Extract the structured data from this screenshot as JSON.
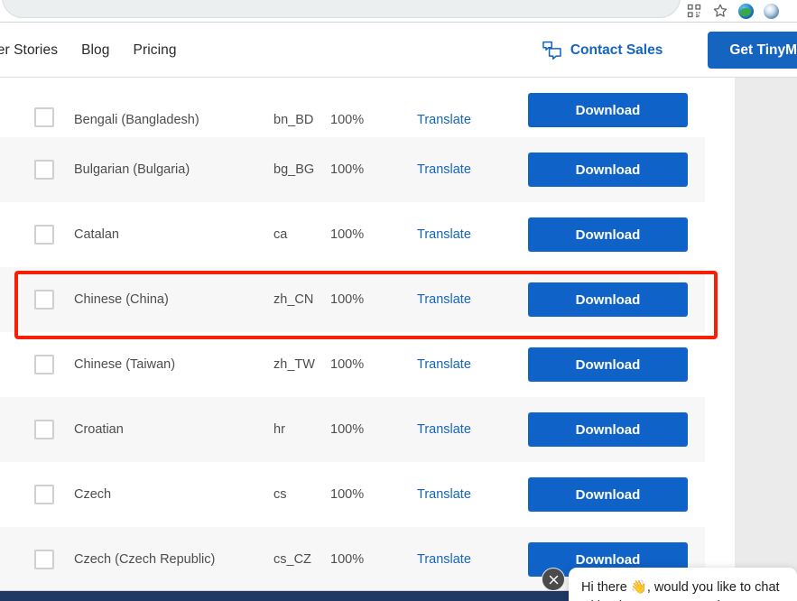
{
  "browser": {
    "icons": [
      {
        "name": "qr-code-icon",
        "glyph": "qr"
      },
      {
        "name": "bookmark-star-icon",
        "glyph": "star"
      },
      {
        "name": "extension-globe-icon",
        "glyph": "globe"
      },
      {
        "name": "extension-swirl-icon",
        "glyph": "swirl"
      }
    ]
  },
  "header": {
    "nav_links": [
      {
        "label": "ner Stories"
      },
      {
        "label": "Blog"
      },
      {
        "label": "Pricing"
      }
    ],
    "contact_sales_label": "Contact Sales",
    "contact_sales_icon": "chat-bubbles-icon",
    "cta_label": "Get TinyM",
    "accent_color": "#1565c0"
  },
  "table": {
    "columns": [
      "select",
      "language",
      "code",
      "progress",
      "translate",
      "download"
    ],
    "translate_label": "Translate",
    "download_label": "Download",
    "rows": [
      {
        "language": "Bengali (Bangladesh)",
        "code": "bn_BD",
        "progress": "100%",
        "striped": false,
        "highlighted": false
      },
      {
        "language": "Bulgarian (Bulgaria)",
        "code": "bg_BG",
        "progress": "100%",
        "striped": true,
        "highlighted": false
      },
      {
        "language": "Catalan",
        "code": "ca",
        "progress": "100%",
        "striped": false,
        "highlighted": false
      },
      {
        "language": "Chinese (China)",
        "code": "zh_CN",
        "progress": "100%",
        "striped": true,
        "highlighted": true
      },
      {
        "language": "Chinese (Taiwan)",
        "code": "zh_TW",
        "progress": "100%",
        "striped": false,
        "highlighted": false
      },
      {
        "language": "Croatian",
        "code": "hr",
        "progress": "100%",
        "striped": true,
        "highlighted": false
      },
      {
        "language": "Czech",
        "code": "cs",
        "progress": "100%",
        "striped": false,
        "highlighted": false
      },
      {
        "language": "Czech (Czech Republic)",
        "code": "cs_CZ",
        "progress": "100%",
        "striped": true,
        "highlighted": false
      }
    ]
  },
  "highlight": {
    "color": "#f81f09",
    "target_row": "Chinese (China)"
  },
  "chat": {
    "message": "Hi there 👋, would you like to chat with a human on our sales team?",
    "close_icon": "close-icon"
  },
  "colors": {
    "button_blue": "#0f62c8",
    "link_blue": "#1565c0",
    "stripe_gray": "#f7f7f7",
    "gutter_gray": "#ebebeb",
    "bottom_bar": "#1f3864"
  }
}
